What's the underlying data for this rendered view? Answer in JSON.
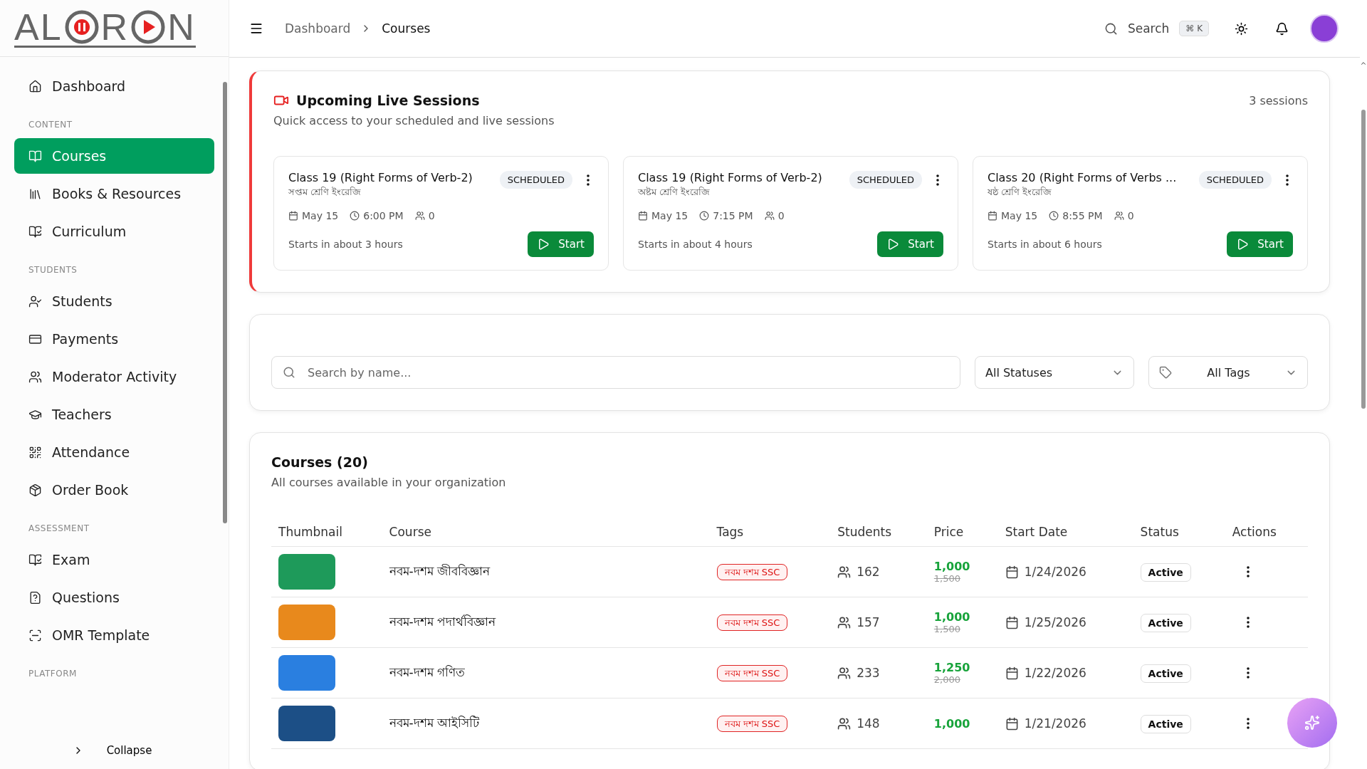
{
  "logo": {
    "parts": [
      "AL",
      "R",
      "N"
    ]
  },
  "sidebar": {
    "sections": [
      {
        "items": [
          {
            "label": "Dashboard",
            "selected": false
          }
        ]
      },
      {
        "heading": "CONTENT",
        "items": [
          {
            "label": "Courses",
            "selected": true
          },
          {
            "label": "Books & Resources",
            "selected": false
          },
          {
            "label": "Curriculum",
            "selected": false
          }
        ]
      },
      {
        "heading": "STUDENTS",
        "items": [
          {
            "label": "Students",
            "selected": false
          },
          {
            "label": "Payments",
            "selected": false
          },
          {
            "label": "Moderator Activity",
            "selected": false
          },
          {
            "label": "Teachers",
            "selected": false
          },
          {
            "label": "Attendance",
            "selected": false
          },
          {
            "label": "Order Book",
            "selected": false
          }
        ]
      },
      {
        "heading": "ASSESSMENT",
        "items": [
          {
            "label": "Exam",
            "selected": false
          },
          {
            "label": "Questions",
            "selected": false
          },
          {
            "label": "OMR Template",
            "selected": false
          }
        ]
      },
      {
        "heading": "PLATFORM"
      }
    ],
    "collapse": "Collapse"
  },
  "header": {
    "breadcrumb": [
      "Dashboard",
      "Courses"
    ],
    "search": "Search",
    "shortcut": "⌘ K"
  },
  "live_sessions": {
    "title": "Upcoming Live Sessions",
    "subtitle": "Quick access to your scheduled and live sessions",
    "count": "3 sessions",
    "sessions": [
      {
        "title": "Class 19 (Right Forms of Verb-2)",
        "subject": "সপ্তম শ্রেণি ইংরেজি",
        "status": "SCHEDULED",
        "date": "May 15",
        "time": "6:00 PM",
        "attendees": "0",
        "eta": "Starts in about 3 hours",
        "action": "Start"
      },
      {
        "title": "Class 19 (Right Forms of Verb-2)",
        "subject": "অষ্টম শ্রেণি ইংরেজি",
        "status": "SCHEDULED",
        "date": "May 15",
        "time": "7:15 PM",
        "attendees": "0",
        "eta": "Starts in about 4 hours",
        "action": "Start"
      },
      {
        "title": "Class 20 (Right Forms of Verbs ...",
        "subject": "ষষ্ঠ শ্রেণি ইংরেজি",
        "status": "SCHEDULED",
        "date": "May 15",
        "time": "8:55 PM",
        "attendees": "0",
        "eta": "Starts in about 6 hours",
        "action": "Start"
      }
    ]
  },
  "filters": {
    "search": {
      "placeholder": "Search by name..."
    },
    "status": "All Statuses",
    "tags": "All Tags"
  },
  "courses": {
    "title": "Courses (20)",
    "subtitle": "All courses available in your organization",
    "columns": [
      "Thumbnail",
      "Course",
      "Tags",
      "Students",
      "Price",
      "Start Date",
      "Status",
      "Actions"
    ],
    "rows": [
      {
        "name": "নবম-দশম জীববিজ্ঞান",
        "tag": "নবম দশম SSC",
        "students": "162",
        "price": "1,000",
        "old_price": "1,500",
        "start": "1/24/2026",
        "status": "Active"
      },
      {
        "name": "নবম-দশম পদার্থবিজ্ঞান",
        "tag": "নবম দশম SSC",
        "students": "157",
        "price": "1,000",
        "old_price": "1,500",
        "start": "1/25/2026",
        "status": "Active"
      },
      {
        "name": "নবম-দশম গণিত",
        "tag": "নবম দশম SSC",
        "students": "233",
        "price": "1,250",
        "old_price": "2,000",
        "start": "1/22/2026",
        "status": "Active"
      },
      {
        "name": "নবম-দশম আইসিটি",
        "tag": "নবম দশম SSC",
        "students": "148",
        "price": "1,000",
        "start": "1/21/2026",
        "status": "Active"
      }
    ]
  }
}
